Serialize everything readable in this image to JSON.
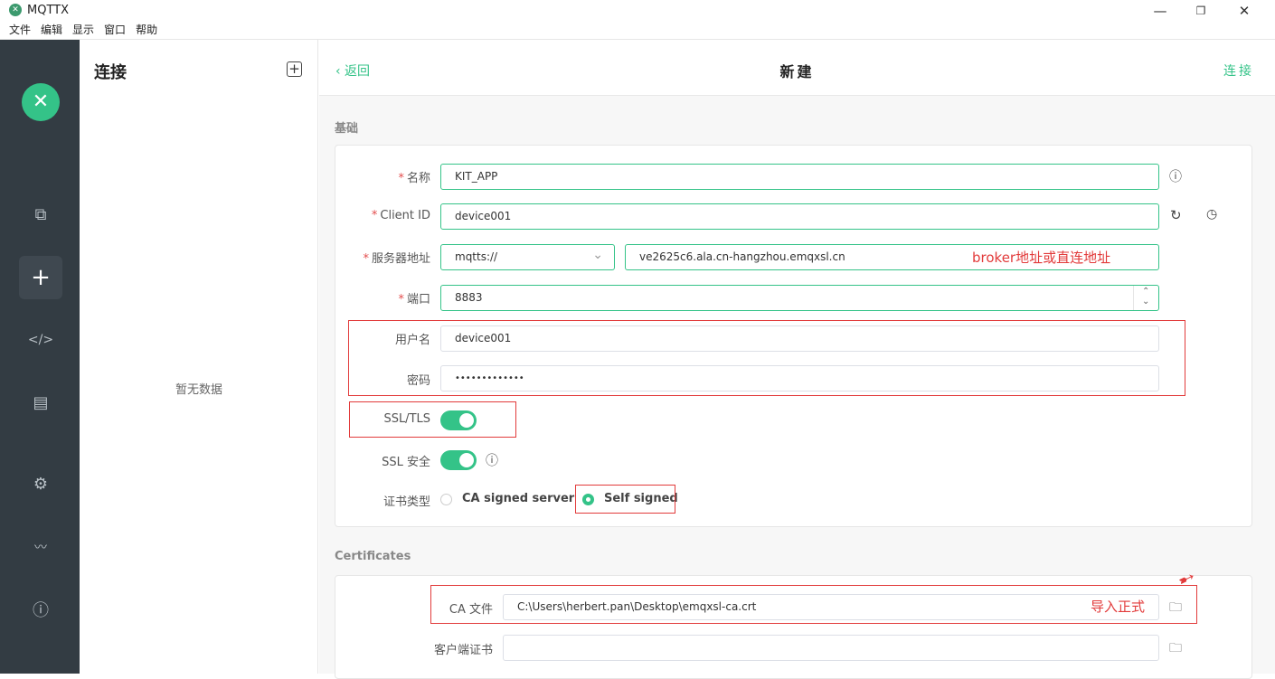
{
  "window": {
    "title": "MQTTX",
    "logo_glyph": "✕",
    "minimize_glyph": "—",
    "restore_glyph": "❐",
    "close_glyph": "✕"
  },
  "menu": [
    "文件",
    "编辑",
    "显示",
    "窗口",
    "帮助"
  ],
  "leftnav": {
    "logo_glyph": "✕",
    "items": [
      {
        "name": "connections-icon",
        "glyph": "⧉"
      },
      {
        "name": "new-connection-icon",
        "glyph": "+"
      },
      {
        "name": "script-icon",
        "glyph": "</>"
      },
      {
        "name": "log-icon",
        "glyph": "▤"
      },
      {
        "name": "settings-icon",
        "glyph": "⚙"
      },
      {
        "name": "feed-icon",
        "glyph": "〰"
      },
      {
        "name": "about-icon",
        "glyph": "ⓘ"
      }
    ]
  },
  "connections": {
    "title": "连接",
    "add_glyph": "+",
    "empty_text": "暂无数据"
  },
  "header": {
    "back_label": "‹ 返回",
    "title": "新建",
    "connect_label": "连接"
  },
  "basic": {
    "section_label": "基础",
    "name_label": "名称",
    "name_value": "KIT_APP",
    "client_id_label": "Client ID",
    "client_id_value": "device001",
    "host_label": "服务器地址",
    "protocol_value": "mqtts://",
    "host_value": "ve2625c6.ala.cn-hangzhou.emqxsl.cn",
    "port_label": "端口",
    "port_value": "8883",
    "username_label": "用户名",
    "username_value": "device001",
    "password_label": "密码",
    "password_value": "•••••••••••••",
    "ssl_label": "SSL/TLS",
    "ssl_secure_label": "SSL 安全",
    "cert_type_label": "证书类型",
    "cert_option_ca": "CA signed server",
    "cert_option_self": "Self signed"
  },
  "certificates": {
    "section_label": "Certificates",
    "ca_file_label": "CA 文件",
    "ca_file_value": "C:\\Users\\herbert.pan\\Desktop\\emqxsl-ca.crt",
    "client_cert_label": "客户端证书"
  },
  "annotations": {
    "broker_note": "broker地址或直连地址",
    "import_note": "导入正式"
  },
  "icons": {
    "info": "ⓘ",
    "refresh": "↻",
    "clock": "◷",
    "chevron_down": "⌄",
    "stepper_up": "⌃",
    "stepper_down": "⌄",
    "folder": "🗀",
    "arrow": "➹"
  },
  "colors": {
    "accent": "#34c388",
    "nav_bg": "#333c43",
    "annotation": "#e23b3b"
  }
}
